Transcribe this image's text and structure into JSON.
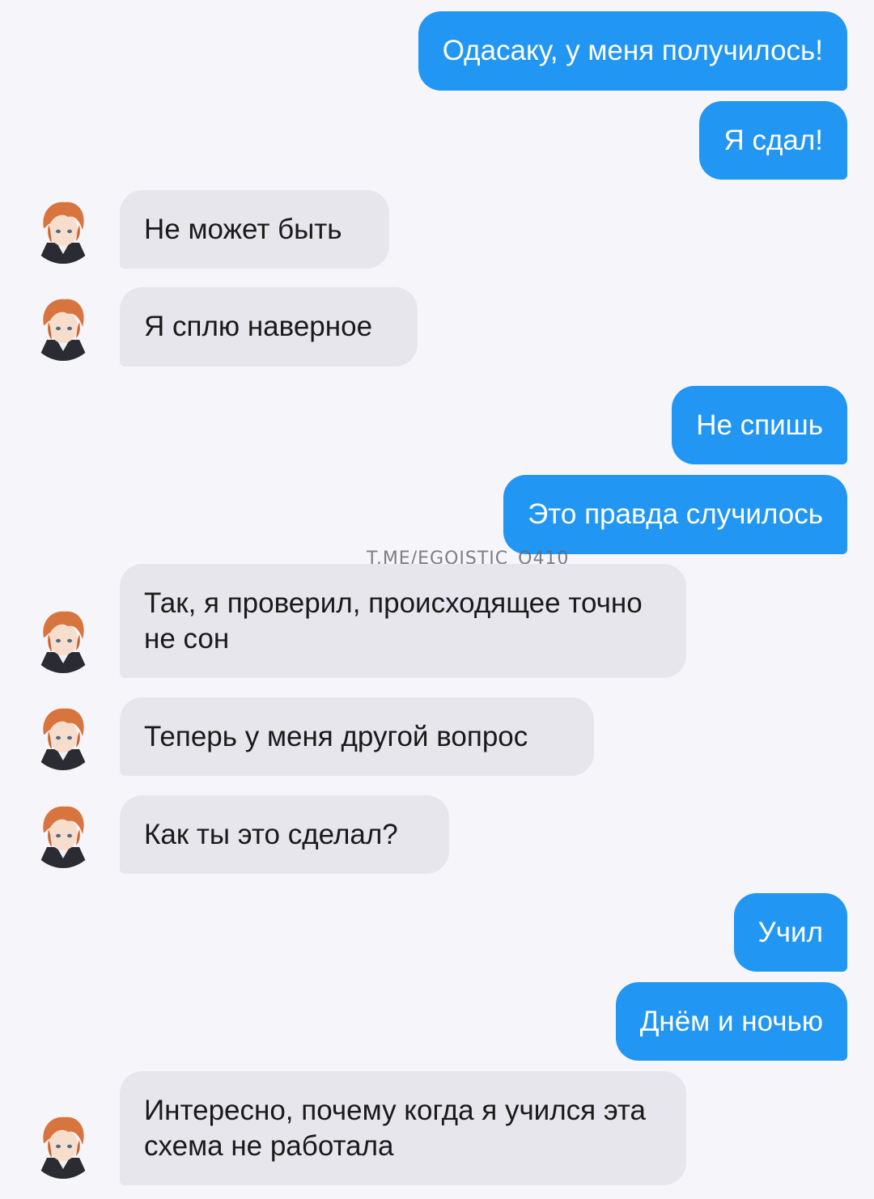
{
  "messages": [
    {
      "side": "out",
      "text": "Одасаку, у меня получилось!"
    },
    {
      "side": "out",
      "text": "Я сдал!"
    },
    {
      "side": "in",
      "text": "Не может быть"
    },
    {
      "side": "in",
      "text": "Я сплю наверное"
    },
    {
      "side": "out",
      "text": "Не спишь"
    },
    {
      "side": "out",
      "text": "Это правда случилось"
    },
    {
      "side": "in",
      "text": "Так, я проверил, происходящее точно не сон"
    },
    {
      "side": "in",
      "text": "Теперь у меня другой вопрос"
    },
    {
      "side": "in",
      "text": "Как ты это сделал?"
    },
    {
      "side": "out",
      "text": "Учил"
    },
    {
      "side": "out",
      "text": "Днём и ночью"
    },
    {
      "side": "in",
      "text": "Интересно, почему когда я учился эта схема не работала"
    }
  ],
  "watermark": "T.ME/EGOISTIC_O410",
  "colors": {
    "background": "#f6f5fa",
    "outgoing_bubble": "#2196f3",
    "incoming_bubble": "#e6e6ec",
    "outgoing_text": "#ffffff",
    "incoming_text": "#1a1a1a"
  }
}
